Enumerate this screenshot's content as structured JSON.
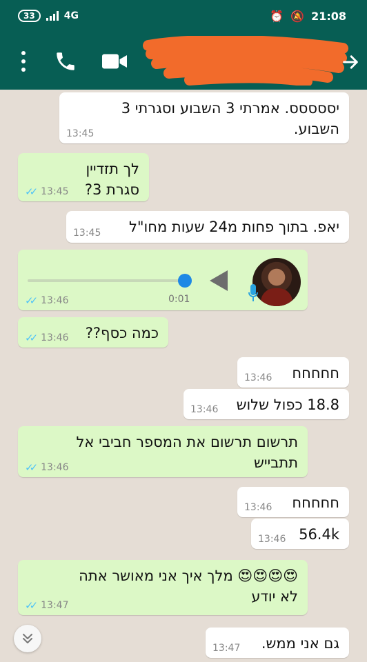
{
  "status_bar": {
    "battery_badge": "33",
    "network": "4G",
    "time": "21:08"
  },
  "app_bar": {
    "contact_name": "",
    "icons": [
      "more-vert-icon",
      "phone-icon",
      "video-call-icon",
      "back-arrow-icon"
    ]
  },
  "messages": [
    {
      "dir": "in",
      "text_lines": [
        "יססססס. אמרתי 3 השבוע וסגרתי 3",
        "השבוע."
      ],
      "time": "13:45"
    },
    {
      "dir": "out",
      "text_lines": [
        "לך תזדיין",
        "סגרת 3?"
      ],
      "time": "13:45",
      "read": true
    },
    {
      "dir": "in",
      "text_lines": [
        "יאפ. בתוך פחות מ24 שעות מחו\"ל"
      ],
      "time": "13:45"
    },
    {
      "dir": "out",
      "type": "voice",
      "duration": "0:01",
      "time": "13:46",
      "read": true
    },
    {
      "dir": "out",
      "text_lines": [
        "כמה כסף??"
      ],
      "time": "13:46",
      "read": true
    },
    {
      "dir": "in",
      "text_lines": [
        "חחחחח"
      ],
      "time": "13:46"
    },
    {
      "dir": "in",
      "text_lines": [
        "18.8 כפול שלוש"
      ],
      "time": "13:46"
    },
    {
      "dir": "out",
      "text_lines": [
        "תרשום תרשום את המספר חביבי אל",
        "תתבייש"
      ],
      "time": "13:46",
      "read": true
    },
    {
      "dir": "in",
      "text_lines": [
        "חחחחח"
      ],
      "time": "13:46"
    },
    {
      "dir": "in",
      "text_lines": [
        "56.4k"
      ],
      "time": "13:46"
    },
    {
      "dir": "out",
      "text_lines": [
        "😍😍😍😍 מלך איך אני מאושר אתה",
        "לא יודע"
      ],
      "time": "13:47",
      "read": true
    },
    {
      "dir": "in",
      "text_lines": [
        "גם אני ממש."
      ],
      "time": "13:47"
    }
  ],
  "colors": {
    "header": "#075e54",
    "chat_bg": "#e5ddd5",
    "outgoing_bubble": "#dcf8c6",
    "incoming_bubble": "#ffffff",
    "read_ticks": "#4fc3f7",
    "redaction": "#f26b2b"
  }
}
